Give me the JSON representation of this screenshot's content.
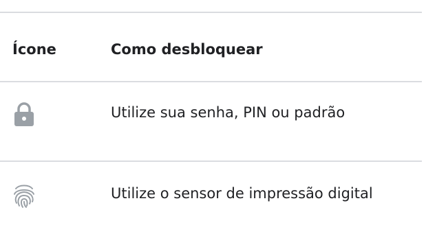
{
  "table": {
    "headers": {
      "icon": "Ícone",
      "method": "Como desbloquear"
    },
    "rows": [
      {
        "icon": "lock-icon",
        "text": "Utilize sua senha, PIN ou padrão"
      },
      {
        "icon": "fingerprint-icon",
        "text": "Utilize o sensor de impressão digital"
      }
    ]
  },
  "colors": {
    "icon_gray": "#9aa0a6",
    "divider": "#dadce0",
    "text": "#202124"
  }
}
